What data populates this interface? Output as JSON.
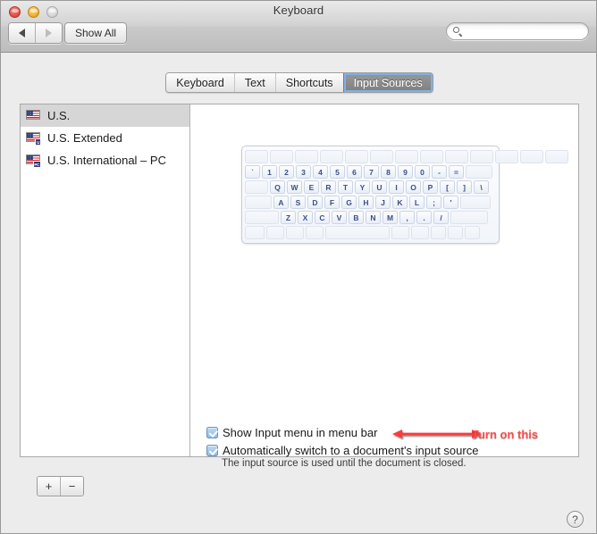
{
  "window": {
    "title": "Keyboard",
    "traffic_lights": [
      "close",
      "minimize",
      "zoom"
    ]
  },
  "toolbar": {
    "back_label": "◀",
    "forward_label": "▶",
    "show_all_label": "Show All",
    "search": {
      "value": "",
      "placeholder": "",
      "icon": "search-icon"
    }
  },
  "tabs": [
    {
      "label": "Keyboard",
      "selected": false
    },
    {
      "label": "Text",
      "selected": false
    },
    {
      "label": "Shortcuts",
      "selected": false
    },
    {
      "label": "Input Sources",
      "selected": true
    }
  ],
  "input_sources": [
    {
      "label": "U.S.",
      "badge": "",
      "selected": true
    },
    {
      "label": "U.S. Extended",
      "badge": "U",
      "selected": false
    },
    {
      "label": "U.S. International – PC",
      "badge": "PC",
      "selected": false
    }
  ],
  "list_controls": {
    "add_label": "+",
    "remove_label": "−"
  },
  "keyboard_preview": {
    "rows": [
      {
        "keys": [
          "",
          "",
          "",
          "",
          "",
          "",
          "",
          "",
          "",
          "",
          "",
          "",
          ""
        ],
        "widths": [
          26,
          26,
          26,
          26,
          26,
          26,
          26,
          26,
          26,
          26,
          26,
          26,
          26
        ]
      },
      {
        "keys": [
          "`",
          "1",
          "2",
          "3",
          "4",
          "5",
          "6",
          "7",
          "8",
          "9",
          "0",
          "-",
          "=",
          ""
        ],
        "widths": [
          17,
          17,
          17,
          17,
          17,
          17,
          17,
          17,
          17,
          17,
          17,
          17,
          17,
          30
        ]
      },
      {
        "keys": [
          "",
          "Q",
          "W",
          "E",
          "R",
          "T",
          "Y",
          "U",
          "I",
          "O",
          "P",
          "[",
          "]",
          "\\"
        ],
        "widths": [
          26,
          17,
          17,
          17,
          17,
          17,
          17,
          17,
          17,
          17,
          17,
          17,
          17,
          17
        ]
      },
      {
        "keys": [
          "",
          "A",
          "S",
          "D",
          "F",
          "G",
          "H",
          "J",
          "K",
          "L",
          ";",
          "'",
          ""
        ],
        "widths": [
          30,
          17,
          17,
          17,
          17,
          17,
          17,
          17,
          17,
          17,
          17,
          17,
          34
        ]
      },
      {
        "keys": [
          "",
          "Z",
          "X",
          "C",
          "V",
          "B",
          "N",
          "M",
          ",",
          ".",
          "/",
          ""
        ],
        "widths": [
          38,
          17,
          17,
          17,
          17,
          17,
          17,
          17,
          17,
          17,
          17,
          42
        ]
      },
      {
        "keys": [
          "",
          "",
          "",
          "",
          "",
          "",
          "",
          "",
          "",
          ""
        ],
        "widths": [
          22,
          20,
          20,
          20,
          72,
          20,
          20,
          17,
          17,
          17
        ]
      }
    ]
  },
  "options": [
    {
      "label": "Show Input menu in menu bar",
      "checked": true
    },
    {
      "label": "Automatically switch to a document's input source",
      "checked": true
    }
  ],
  "help_text": "The input source is used until the document is closed.",
  "annotation": {
    "text": "Turn on this",
    "color": "#fb4b4b",
    "arrow": "double-headed-arrow"
  },
  "help_button": {
    "label": "?"
  }
}
